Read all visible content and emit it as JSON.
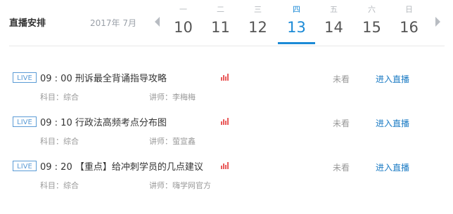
{
  "header": {
    "title": "直播安排",
    "month": "2017年 7月",
    "days": [
      {
        "weekday": "一",
        "date": "10",
        "active": false
      },
      {
        "weekday": "二",
        "date": "11",
        "active": false
      },
      {
        "weekday": "三",
        "date": "12",
        "active": false
      },
      {
        "weekday": "四",
        "date": "13",
        "active": true
      },
      {
        "weekday": "五",
        "date": "14",
        "active": false
      },
      {
        "weekday": "六",
        "date": "15",
        "active": false
      },
      {
        "weekday": "日",
        "date": "16",
        "active": false
      }
    ],
    "accent_color": "#1b8ad6"
  },
  "lessons": [
    {
      "badge": "LIVE",
      "title": "09 : 00 刑诉最全背诵指导攻略",
      "status": "未看",
      "action": "进入直播",
      "subject": "科目：综合",
      "teacher": "讲师：李梅梅"
    },
    {
      "badge": "LIVE",
      "title": "09 : 10 行政法高频考点分布图",
      "status": "未看",
      "action": "进入直播",
      "subject": "科目：综合",
      "teacher": "讲师：萤宣鑫"
    },
    {
      "badge": "LIVE",
      "title": "09 : 20 【重点】给冲刺学员的几点建议",
      "status": "未看",
      "action": "进入直播",
      "subject": "科目：综合",
      "teacher": "讲师：嗨学网官方"
    }
  ]
}
